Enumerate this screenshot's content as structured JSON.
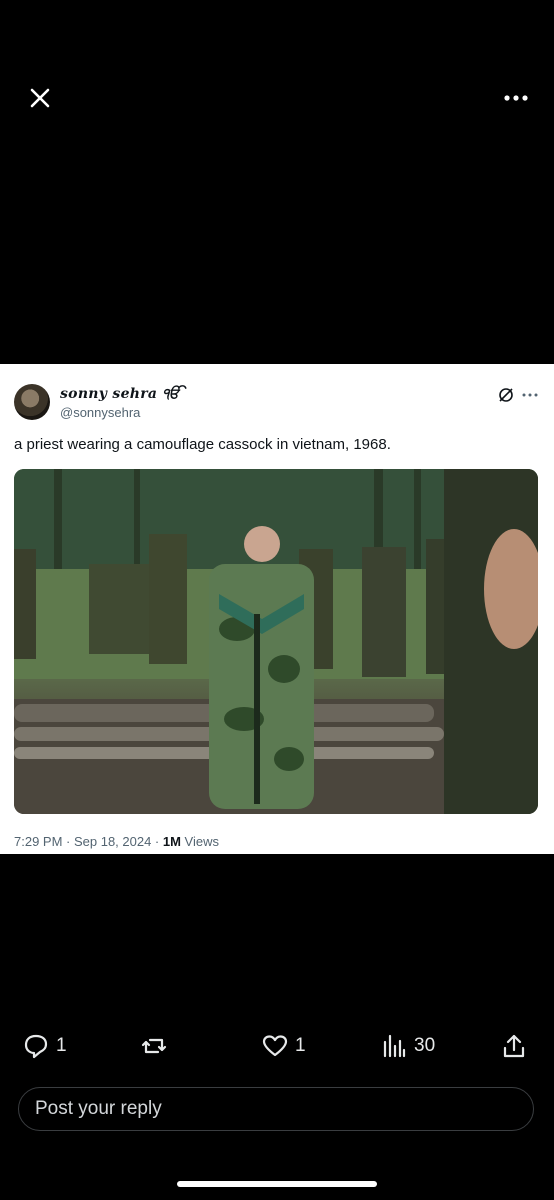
{
  "tweet": {
    "display_name": "sonny sehra ੴ",
    "handle": "@sonnysehra",
    "text": "a priest wearing a camouflage cassock in vietnam, 1968.",
    "time": "7:29 PM · Sep 18, 2024 · ",
    "views_count": "1M",
    "views_label": " Views"
  },
  "actions": {
    "replies": "1",
    "reposts": "",
    "likes": "1",
    "views": "30"
  },
  "reply": {
    "placeholder": "Post your reply"
  },
  "icons": [
    "close-icon",
    "more-icon",
    "edit-icon",
    "reply-icon",
    "repost-icon",
    "like-icon",
    "views-icon",
    "share-icon"
  ]
}
